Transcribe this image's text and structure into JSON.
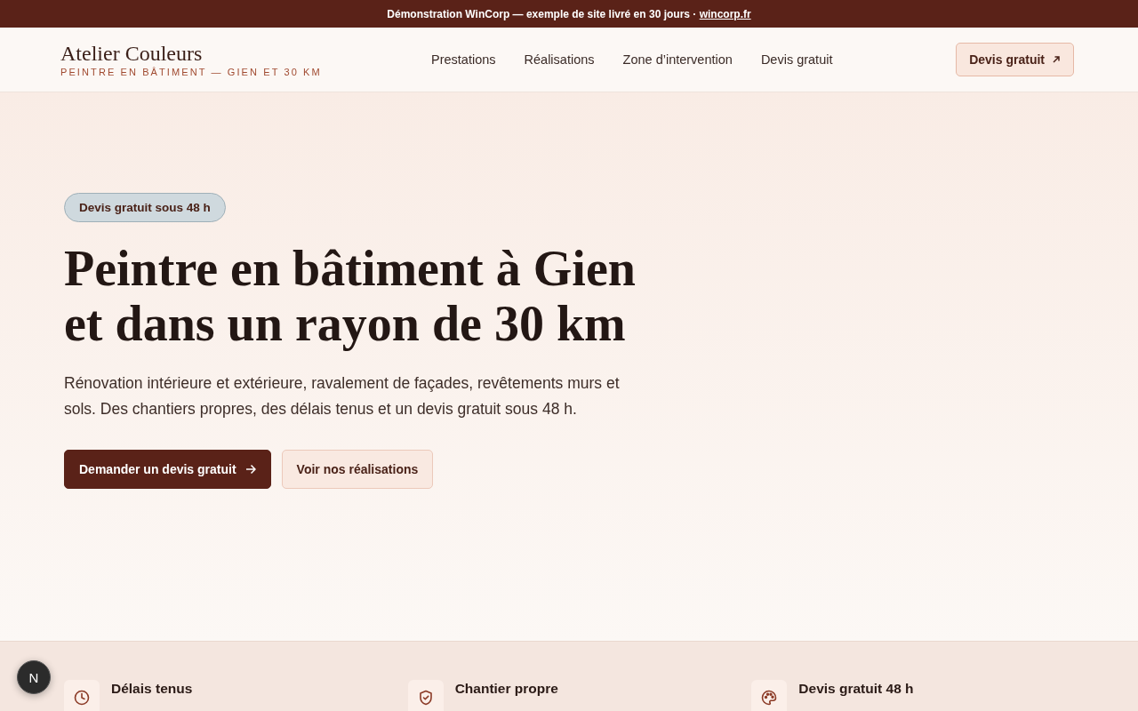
{
  "announcement": {
    "text": "Démonstration WinCorp — exemple de site livré en 30 jours · ",
    "link": "wincorp.fr"
  },
  "header": {
    "brand": "Atelier Couleurs",
    "tagline": "PEINTRE EN BÂTIMENT — GIEN ET 30 KM",
    "nav": [
      "Prestations",
      "Réalisations",
      "Zone d’intervention",
      "Devis gratuit"
    ],
    "cta": "Devis gratuit"
  },
  "hero": {
    "badge": "Devis gratuit sous 48 h",
    "title": "Peintre en bâtiment à Gien et dans un rayon de 30 km",
    "lead": "Rénovation intérieure et extérieure, ravalement de façades, revêtements murs et sols. Des chantiers propres, des délais tenus et un devis gratuit sous 48 h.",
    "buttons": [
      {
        "label": "Demander un devis gratuit",
        "kind": "primary"
      },
      {
        "label": "Voir nos réalisations",
        "kind": "secondary"
      }
    ]
  },
  "features": [
    {
      "title": "Délais tenus",
      "kind": "clock"
    },
    {
      "title": "Chantier propre",
      "kind": "shield"
    },
    {
      "title": "Devis gratuit 48 h",
      "kind": "palette"
    }
  ],
  "dev_badge": "N"
}
